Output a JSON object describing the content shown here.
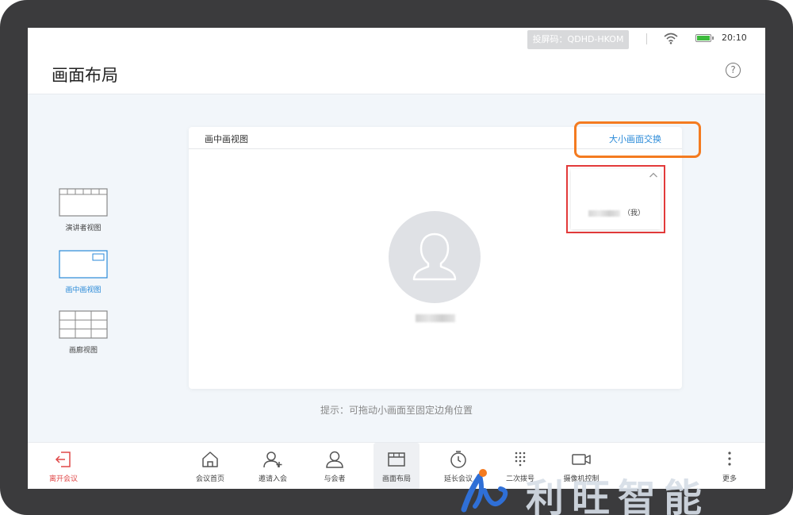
{
  "status_bar": {
    "cast_code": "投屏码：QDHD-HKOM",
    "time": "20:10",
    "wifi_icon": "wifi-icon",
    "battery_icon": "battery-icon",
    "battery_level": 1.0
  },
  "header": {
    "title": "画面布局",
    "help_icon": "?"
  },
  "layouts": [
    {
      "label": "演讲者视图",
      "icon": "speaker-view-icon",
      "selected": false
    },
    {
      "label": "画中画视图",
      "icon": "pip-view-icon",
      "selected": true
    },
    {
      "label": "画廊视图",
      "icon": "gallery-view-icon",
      "selected": false
    }
  ],
  "preview": {
    "title": "画中画视图",
    "swap_label": "大小画面交换",
    "small_view_suffix": "（我）",
    "collapse_icon": "chevron-up-icon",
    "avatar_icon": "user-avatar-icon"
  },
  "hint": "提示：可拖动小画面至固定边角位置",
  "toolbar": {
    "leave": "离开会议",
    "items": [
      {
        "label": "会议首页",
        "icon": "home-icon"
      },
      {
        "label": "邀请入会",
        "icon": "invite-user-icon"
      },
      {
        "label": "与会者",
        "icon": "participants-icon"
      },
      {
        "label": "画面布局",
        "icon": "layout-icon"
      },
      {
        "label": "延长会议",
        "icon": "timer-icon"
      },
      {
        "label": "二次拨号",
        "icon": "dialpad-icon"
      },
      {
        "label": "摄像机控制",
        "icon": "camera-icon"
      },
      {
        "label": "更多",
        "icon": "more-vertical-icon"
      }
    ]
  },
  "colors": {
    "accent": "#2a8ad8",
    "danger": "#e04848",
    "highlight_orange": "#f47b20",
    "highlight_red": "#e23a3a"
  },
  "watermark": {
    "text": "利旺智能"
  }
}
